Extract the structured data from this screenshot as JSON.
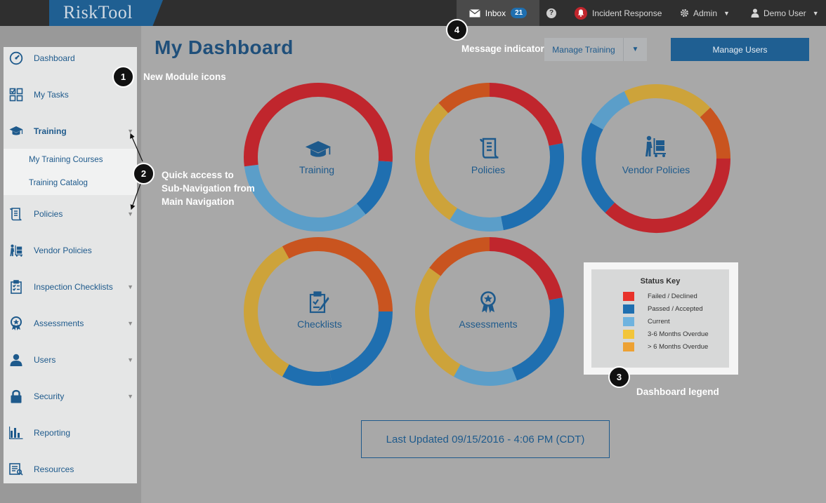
{
  "header": {
    "logo": "RiskTool",
    "inbox_label": "Inbox",
    "inbox_count": "21",
    "help_icon": "?",
    "incident_label": "Incident Response",
    "admin_label": "Admin",
    "user_label": "Demo User",
    "colors": {
      "bar": "#2f2f2f",
      "brand": "#1f5f92",
      "alert": "#c0262d"
    }
  },
  "sidebar": {
    "items": [
      {
        "label": "Dashboard",
        "icon": "gauge-icon",
        "caret": false
      },
      {
        "label": "My Tasks",
        "icon": "tasks-grid-icon",
        "caret": false
      },
      {
        "label": "Training",
        "icon": "graduation-cap-icon",
        "caret": true,
        "active": true
      },
      {
        "label": "Policies",
        "icon": "scroll-icon",
        "caret": true
      },
      {
        "label": "Vendor Policies",
        "icon": "vendor-dolly-icon",
        "caret": false
      },
      {
        "label": "Inspection Checklists",
        "icon": "checklist-icon",
        "caret": true
      },
      {
        "label": "Assessments",
        "icon": "award-ribbon-icon",
        "caret": true
      },
      {
        "label": "Users",
        "icon": "user-icon",
        "caret": true
      },
      {
        "label": "Security",
        "icon": "lock-icon",
        "caret": true
      },
      {
        "label": "Reporting",
        "icon": "bar-chart-icon",
        "caret": false
      },
      {
        "label": "Resources",
        "icon": "resources-book-icon",
        "caret": false
      }
    ],
    "training_subnav": [
      "My Training Courses",
      "Training Catalog"
    ]
  },
  "main": {
    "title": "My Dashboard",
    "manage_training_label": "Manage Training",
    "manage_users_label": "Manage Users",
    "last_updated": "Last Updated 09/15/2016 - 4:06 PM (CDT)"
  },
  "status_colors": {
    "failed": "#c0262d",
    "passed": "#1f6fb0",
    "current": "#5b9ec9",
    "overdue_3_6": "#cda33a",
    "overdue_6_plus": "#c9541f"
  },
  "modules": [
    {
      "label": "Training",
      "icon": "graduation-cap-icon",
      "segments": [
        {
          "status": "failed",
          "fraction": 0.26
        },
        {
          "status": "passed",
          "fraction": 0.13
        },
        {
          "status": "current",
          "fraction": 0.34
        },
        {
          "status": "failed",
          "fraction": 0.27
        }
      ]
    },
    {
      "label": "Policies",
      "icon": "scroll-icon",
      "segments": [
        {
          "status": "failed",
          "fraction": 0.22
        },
        {
          "status": "passed",
          "fraction": 0.25
        },
        {
          "status": "current",
          "fraction": 0.12
        },
        {
          "status": "overdue_3_6",
          "fraction": 0.29
        },
        {
          "status": "overdue_6_plus",
          "fraction": 0.12
        }
      ]
    },
    {
      "label": "Vendor Policies",
      "icon": "vendor-dolly-icon",
      "segments": [
        {
          "status": "overdue_3_6",
          "fraction": 0.13
        },
        {
          "status": "overdue_6_plus",
          "fraction": 0.12
        },
        {
          "status": "failed",
          "fraction": 0.37
        },
        {
          "status": "passed",
          "fraction": 0.21
        },
        {
          "status": "current",
          "fraction": 0.1
        },
        {
          "status": "overdue_3_6",
          "fraction": 0.07
        }
      ]
    },
    {
      "label": "Checklists",
      "icon": "checklist-icon",
      "segments": [
        {
          "status": "overdue_6_plus",
          "fraction": 0.25
        },
        {
          "status": "passed",
          "fraction": 0.22
        },
        {
          "status": "passed",
          "fraction": 0.11
        },
        {
          "status": "overdue_3_6",
          "fraction": 0.34
        },
        {
          "status": "overdue_6_plus",
          "fraction": 0.08
        }
      ]
    },
    {
      "label": "Assessments",
      "icon": "award-ribbon-icon",
      "segments": [
        {
          "status": "failed",
          "fraction": 0.22
        },
        {
          "status": "passed",
          "fraction": 0.22
        },
        {
          "status": "current",
          "fraction": 0.14
        },
        {
          "status": "overdue_3_6",
          "fraction": 0.27
        },
        {
          "status": "overdue_6_plus",
          "fraction": 0.15
        }
      ]
    }
  ],
  "legend": {
    "title": "Status Key",
    "items": [
      {
        "label": "Failed / Declined",
        "color": "#e8322a"
      },
      {
        "label": "Passed / Accepted",
        "color": "#1f6fb0"
      },
      {
        "label": "Current",
        "color": "#6fb3df"
      },
      {
        "label": "3-6 Months Overdue",
        "color": "#f2c53a"
      },
      {
        "label": "> 6 Months Overdue",
        "color": "#eda133"
      }
    ]
  },
  "annotations": {
    "c1_num": "1",
    "c1_text": "New Module icons",
    "c2_num": "2",
    "c2_line1": "Quick access to",
    "c2_line2": "Sub-Navigation from",
    "c2_line3": "Main Navigation",
    "c3_num": "3",
    "c3_text": "Dashboard legend",
    "c4_num": "4",
    "c4_text": "Message indicator"
  }
}
